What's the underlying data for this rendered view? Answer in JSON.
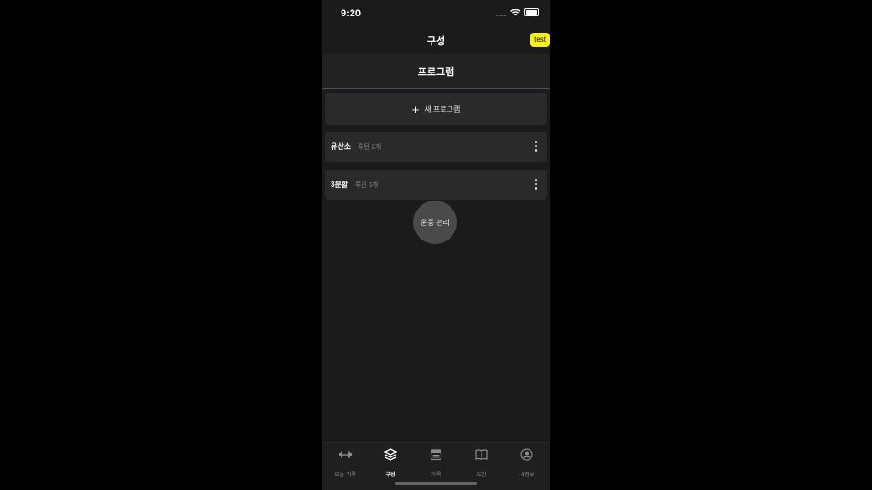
{
  "status_bar": {
    "time": "9:20"
  },
  "nav": {
    "title": "구성",
    "test_badge": "test"
  },
  "section": {
    "title": "프로그램"
  },
  "new_program": {
    "icon": "plus-icon",
    "label": "새 프로그램"
  },
  "programs": [
    {
      "name": "유산소",
      "subtitle": "루틴 1개"
    },
    {
      "name": "3분할",
      "subtitle": "루틴 1개"
    }
  ],
  "fab": {
    "label": "운동 관리"
  },
  "tabs": [
    {
      "label": "오늘 기록",
      "icon": "dumbbell-icon"
    },
    {
      "label": "구성",
      "icon": "layers-icon"
    },
    {
      "label": "기록",
      "icon": "calendar-icon"
    },
    {
      "label": "도감",
      "icon": "book-icon"
    },
    {
      "label": "내정보",
      "icon": "user-icon"
    }
  ],
  "colors": {
    "background": "#1b1b1b",
    "card": "#2a2a2a",
    "accent": "#f5ef1a",
    "divider": "#4a4f5e"
  }
}
